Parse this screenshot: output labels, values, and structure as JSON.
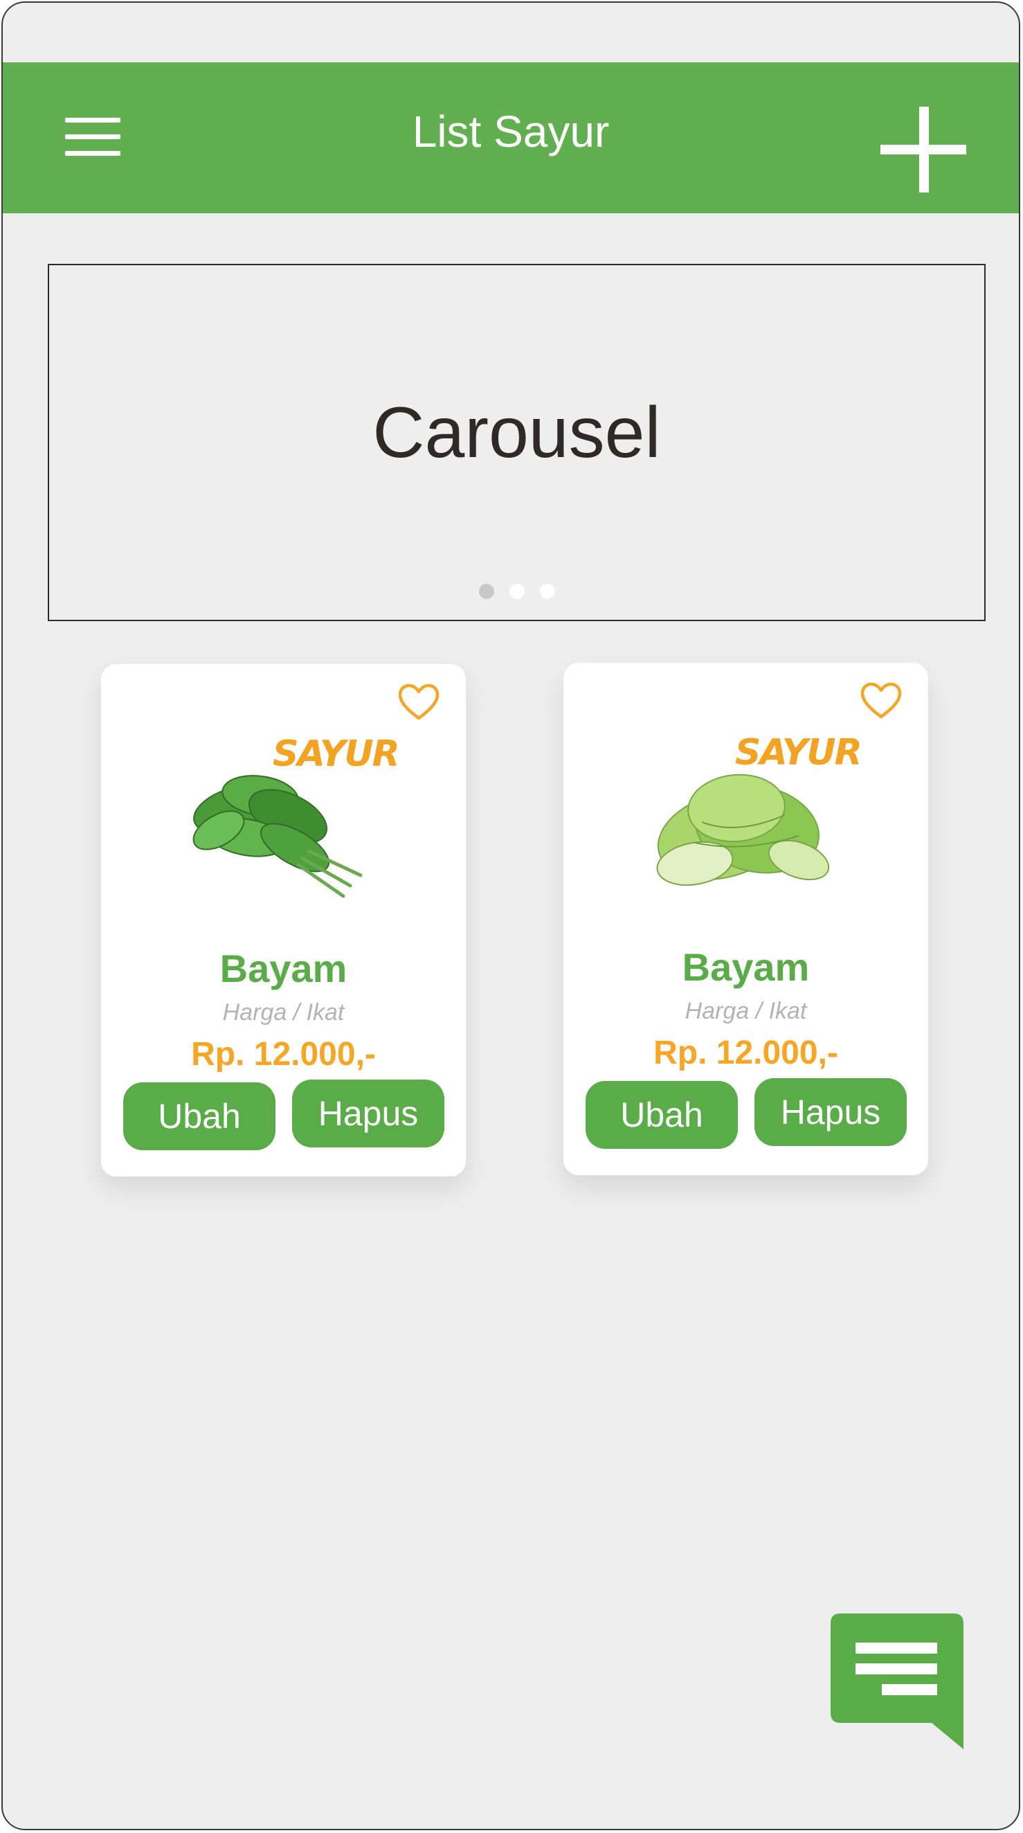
{
  "header": {
    "title": "List Sayur",
    "menu_icon": "hamburger-menu-icon",
    "add_icon": "plus-icon"
  },
  "carousel": {
    "label": "Carousel",
    "dot_count": 3,
    "active_index": 0
  },
  "products": [
    {
      "name": "Bayam",
      "unit": "Harga / Ikat",
      "price": "Rp. 12.000,-",
      "brand": "SAYUR",
      "edit_label": "Ubah",
      "delete_label": "Hapus",
      "image": "spinach-image"
    },
    {
      "name": "Bayam",
      "unit": "Harga / Ikat",
      "price": "Rp. 12.000,-",
      "brand": "SAYUR",
      "edit_label": "Ubah",
      "delete_label": "Hapus",
      "image": "lettuce-image"
    }
  ],
  "colors": {
    "primary": "#62af52",
    "accent": "#f6a524",
    "background": "#eeeeee",
    "muted_text": "#b3b3b3"
  },
  "fab": {
    "icon": "chat-message-icon"
  }
}
